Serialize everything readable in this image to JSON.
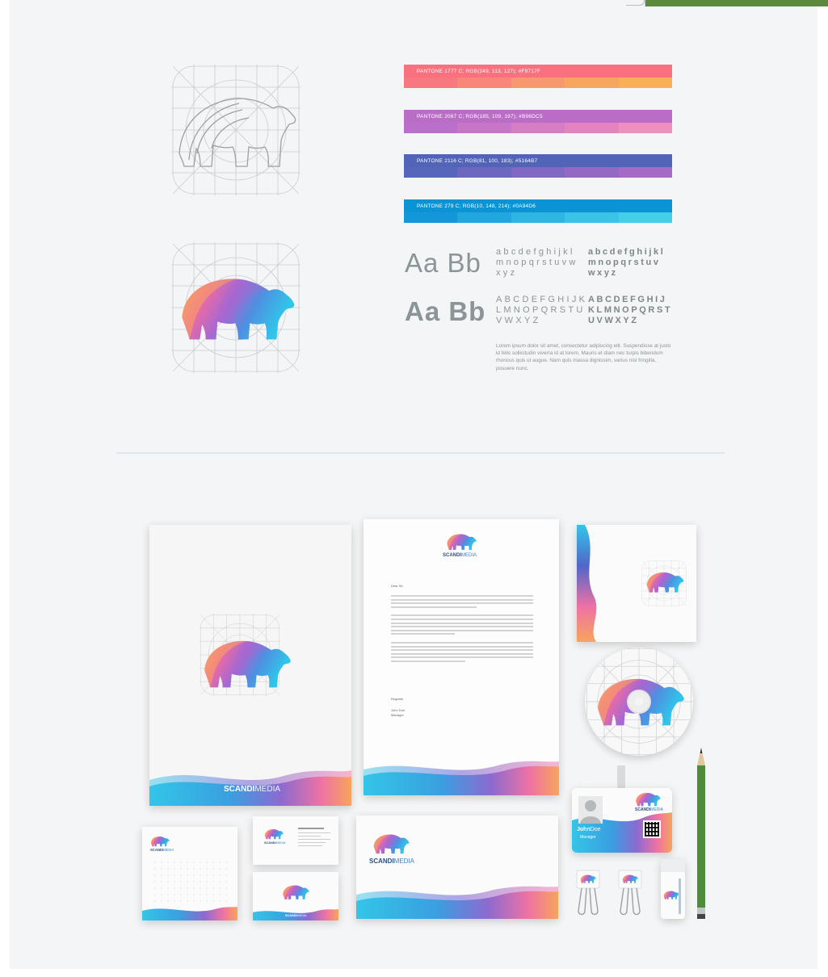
{
  "swatches": [
    {
      "label": "PANTONE 1777 C; RGB(249, 113, 127); #F9717F",
      "top": "#f9717f",
      "cells": [
        "#f7787e",
        "#f8877a",
        "#f79870",
        "#f7a660",
        "#f8b058"
      ]
    },
    {
      "label": "PANTONE 2067 C; RGB(185, 109, 197); #B96DC5",
      "top": "#b96dc5",
      "cells": [
        "#bb6fcc",
        "#c875c8",
        "#d67dc3",
        "#e583bf",
        "#ef8fbd"
      ]
    },
    {
      "label": "PANTONE 2116 C; RGB(81, 100, 183); #5164B7",
      "top": "#5164b7",
      "cells": [
        "#5666ba",
        "#6c68bf",
        "#8169c3",
        "#9568c4",
        "#a56ac6"
      ]
    },
    {
      "label": "PANTONE 279 C; RGB(10, 148, 214); #0A94D6",
      "top": "#0a94d6",
      "cells": [
        "#1497d8",
        "#22a6de",
        "#2eb5e2",
        "#3ac3e6",
        "#44cfe9"
      ]
    }
  ],
  "typography": {
    "sample_light": "Aa Bb",
    "sample_bold": "Aa Bb",
    "lower_light": "abcdefghijkl\nmnopqrstuvw\nxyz",
    "lower_bold": "abcdefghijkl\nmnopqrstuv\nwxyz",
    "upper_light": "ABCDEFGHIJK\nLMNOPQRSTU\nVWXYZ",
    "upper_bold": "ABCDEFGHIJ\nKLMNOPQRST\nUVWXYZ",
    "lorem": "Lorem ipsum dolor sit amet, consectetur adipiscing elit. Suspendisse at justo id felis sollicitudin viverra id at lorem. Mauris et diam nec turpis bibendum rhoncus quis ut augue. Nam quis massa dignissim, varius nisl fringilla, posuere nunc."
  },
  "brand": {
    "name_bold": "SCANDI",
    "name_light": "MEDIA"
  },
  "letterhead": {
    "salutation": "Dear Sir,",
    "regards": "Regards",
    "signer_name": "John Doe",
    "signer_title": "Manager"
  },
  "badge": {
    "name_bold": "John",
    "name_light": "Doe",
    "role": "Manager"
  },
  "colors": {
    "pink": "#f9717f",
    "purple": "#b96dc5",
    "indigo": "#5164b7",
    "blue": "#0a94d6",
    "cyan": "#3ad0ea",
    "orange": "#f8a45b"
  }
}
